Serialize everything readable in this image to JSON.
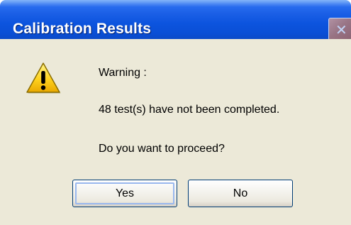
{
  "dialog": {
    "title": "Calibration Results",
    "close_icon": "close-icon"
  },
  "message": {
    "icon": "warning-icon",
    "line1": "Warning :",
    "line2": "48 test(s) have not been completed.",
    "line3": "Do you want to proceed?"
  },
  "buttons": {
    "yes_label": "Yes",
    "no_label": "No"
  },
  "colors": {
    "titlebar": "#0c54de",
    "dialog_background": "#ece9d8",
    "warning_yellow": "#ffd21f",
    "button_border": "#003c74"
  }
}
